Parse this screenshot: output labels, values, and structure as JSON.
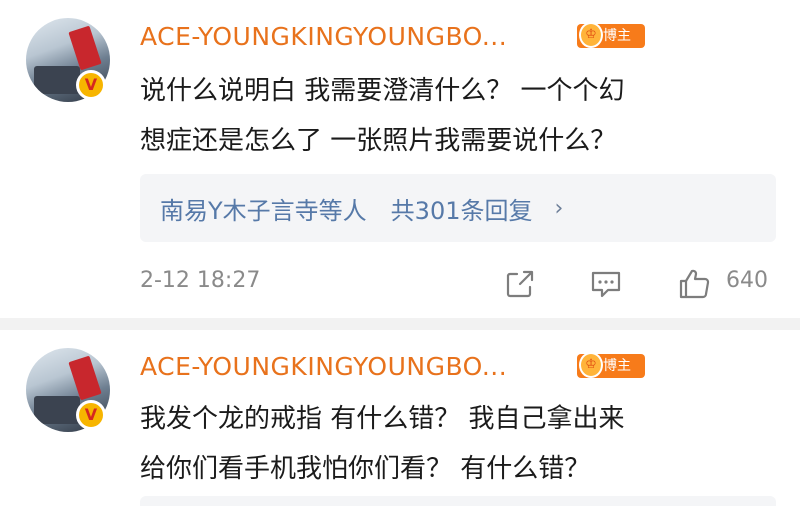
{
  "comments": [
    {
      "username": "ACE-YOUNGKINGYOUNGBO...",
      "badge": "博主",
      "verified": "V",
      "lines": [
        "说什么说明白 我需要澄清什么？ 一个个幻",
        "想症还是怎么了 一张照片我需要说什么？"
      ],
      "replies": {
        "names": "南易Y木子言寺等人",
        "count": "共301条回复",
        "chevron": "›"
      },
      "timestamp": "2-12 18:27",
      "likes": "640"
    },
    {
      "username": "ACE-YOUNGKINGYOUNGBO...",
      "badge": "博主",
      "verified": "V",
      "lines": [
        "我发个龙的戒指 有什么错？ 我自己拿出来",
        "给你们看手机我怕你们看？ 有什么错？"
      ]
    }
  ],
  "colors": {
    "username": "#e8721c",
    "link": "#5679a8",
    "badge": "#f77b1a",
    "meta": "#8a8a8a"
  },
  "icons": [
    "share-icon",
    "reply-icon",
    "like-icon",
    "verified-badge-icon",
    "blogger-medal-icon"
  ]
}
